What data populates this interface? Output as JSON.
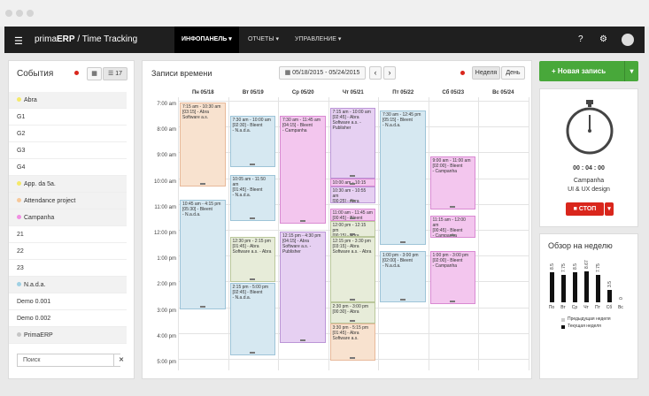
{
  "header": {
    "brand_prefix": "prima",
    "brand_bold": "ERP",
    "brand_suffix": " / Time Tracking",
    "nav": [
      {
        "label": "ИНФОПАНЕЛЬ ▾"
      },
      {
        "label": "ОТЧЕТЫ ▾"
      },
      {
        "label": "УПРАВЛЕНИЕ ▾"
      }
    ]
  },
  "events_panel": {
    "title": "События",
    "count": "17",
    "items": [
      {
        "label": "Abra",
        "color": "#f5e96a"
      },
      {
        "label": "G1",
        "color": ""
      },
      {
        "label": "G2",
        "color": ""
      },
      {
        "label": "G3",
        "color": ""
      },
      {
        "label": "G4",
        "color": ""
      },
      {
        "label": "App. da 5a.",
        "color": "#f5e96a"
      },
      {
        "label": "Attendance project",
        "color": "#f7c89a"
      },
      {
        "label": "Campanha",
        "color": "#f08fe2"
      },
      {
        "label": "21",
        "color": ""
      },
      {
        "label": "22",
        "color": ""
      },
      {
        "label": "23",
        "color": ""
      },
      {
        "label": "N.a.d.a.",
        "color": "#9fd0e3"
      },
      {
        "label": "Demo 0.001",
        "color": ""
      },
      {
        "label": "Demo 0.002",
        "color": ""
      },
      {
        "label": "PrimaERP",
        "color": "#c6c6c6"
      }
    ],
    "search_placeholder": "Поиск",
    "search_clear": "✕"
  },
  "calendar": {
    "title": "Записи времени",
    "date_range": "05/18/2015 - 05/24/2015",
    "prev": "‹",
    "next": "›",
    "view_week": "Неделя",
    "view_day": "День",
    "days": [
      "Пн 05/18",
      "Вт 05/19",
      "Ср 05/20",
      "Чт 05/21",
      "Пт 05/22",
      "Сб 05/23",
      "Вс 05/24"
    ],
    "times": [
      "7:00 am",
      "8:00 am",
      "9:00 am",
      "10:00 am",
      "11:00 am",
      "12:00 pm",
      "1:00 pm",
      "2:00 pm",
      "3:00 pm",
      "4:00 pm",
      "5:00 pm"
    ],
    "events": [
      {
        "day": 0,
        "start": 7.0,
        "end": 10.25,
        "color": "or",
        "time": "7:15 am - 10:30 am",
        "dur": "[03:15] - Abra",
        "desc": "Software a.s."
      },
      {
        "day": 0,
        "start": 10.75,
        "end": 15.0,
        "color": "bl",
        "time": "10:45 am - 4:15 pm",
        "dur": "[05:30] - Bleent",
        "desc": "- N.a.d.a."
      },
      {
        "day": 1,
        "start": 7.5,
        "end": 9.5,
        "color": "bl",
        "time": "7:30 am - 10:00 am",
        "dur": "[02:30] - Bleent",
        "desc": "- N.a.d.a."
      },
      {
        "day": 1,
        "start": 9.8,
        "end": 11.6,
        "color": "bl",
        "time": "10:05 am - 11:50 am",
        "dur": "[01:45] - Bleent",
        "desc": "- N.a.d.a."
      },
      {
        "day": 1,
        "start": 12.2,
        "end": 13.95,
        "color": "gr",
        "time": "12:30 pm - 2:15 pm",
        "dur": "[01:45] - Abra",
        "desc": "Software a.s. - Abra"
      },
      {
        "day": 1,
        "start": 14.0,
        "end": 16.8,
        "color": "bl",
        "time": "2:15 pm - 5:00 pm",
        "dur": "[02:45] - Bleent",
        "desc": "- N.a.d.a."
      },
      {
        "day": 2,
        "start": 7.5,
        "end": 11.7,
        "color": "pk",
        "time": "7:30 am - 11:45 am",
        "dur": "[04:15] - Bleent",
        "desc": "- Campanha"
      },
      {
        "day": 2,
        "start": 12.0,
        "end": 16.3,
        "color": "pu",
        "time": "12:15 pm - 4:30 pm",
        "dur": "[04:15] - Abra",
        "desc": "Software a.s. - Publisher"
      },
      {
        "day": 3,
        "start": 7.2,
        "end": 9.95,
        "color": "pu",
        "time": "7:15 am - 10:00 am",
        "dur": "[02:45] - Abra",
        "desc": "Software a.s. - Publisher"
      },
      {
        "day": 3,
        "start": 9.95,
        "end": 10.25,
        "color": "pk",
        "time": "10:00 am - 10:15",
        "dur": "[00:15] -",
        "desc": ""
      },
      {
        "day": 3,
        "start": 10.25,
        "end": 10.9,
        "color": "pu",
        "time": "10:30 am - 10:55 am",
        "dur": "[00:25] - Abra",
        "desc": "Software a.s. - P"
      },
      {
        "day": 3,
        "start": 11.1,
        "end": 11.6,
        "color": "pk",
        "time": "11:00 am - 11:45 am",
        "dur": "[00:45] - Bleent",
        "desc": ""
      },
      {
        "day": 3,
        "start": 11.6,
        "end": 12.2,
        "color": "gr",
        "time": "12:00 pm - 12:15 pm",
        "dur": "[00:15] - Abra",
        "desc": ""
      },
      {
        "day": 3,
        "start": 12.2,
        "end": 14.75,
        "color": "gr",
        "time": "12:15 pm - 3:30 pm",
        "dur": "[03:15] - Abra",
        "desc": "Software a.s. - Abra"
      },
      {
        "day": 3,
        "start": 14.75,
        "end": 15.55,
        "color": "gr",
        "time": "2:30 pm - 3:00 pm",
        "dur": "[00:30] - Abra",
        "desc": ""
      },
      {
        "day": 3,
        "start": 15.55,
        "end": 17.0,
        "color": "or",
        "time": "3:30 pm - 5:15 pm",
        "dur": "[01:45] - Abra",
        "desc": "Software a.s."
      },
      {
        "day": 4,
        "start": 7.3,
        "end": 12.5,
        "color": "bl",
        "time": "7:30 am - 12:45 pm",
        "dur": "[05:15] - Bleent",
        "desc": "- N.a.d.a."
      },
      {
        "day": 4,
        "start": 12.75,
        "end": 14.75,
        "color": "bl",
        "time": "1:00 pm - 3:00 pm",
        "dur": "[02:00] - Bleent",
        "desc": "- N.a.d.a."
      },
      {
        "day": 5,
        "start": 9.1,
        "end": 11.15,
        "color": "pk",
        "time": "9:00 am - 11:00 am",
        "dur": "[02:00] - Bleent",
        "desc": "- Campanha"
      },
      {
        "day": 5,
        "start": 11.4,
        "end": 12.25,
        "color": "pk",
        "time": "11:15 am - 12:00 am",
        "dur": "[00:45] - Bleent",
        "desc": "- Campanha"
      },
      {
        "day": 5,
        "start": 12.75,
        "end": 14.8,
        "color": "pk",
        "time": "1:00 pm - 3:00 pm",
        "dur": "[02:00] - Bleent",
        "desc": "- Campanha"
      }
    ]
  },
  "new_record": {
    "label": "+ Новая запись",
    "caret": "▾"
  },
  "timer": {
    "elapsed": "00 : 04 : 00",
    "project": "Campanha",
    "task": "UI & UX design",
    "stop_label": "■ СТОП",
    "stop_caret": "▾"
  },
  "week_overview": {
    "title": "Обзор на неделю",
    "days": [
      "По",
      "Вт",
      "Ср",
      "Чт",
      "Пт",
      "Сб",
      "Вс"
    ],
    "labels": [
      "8.5",
      "7.75",
      "8.5",
      "8.67",
      "7.75",
      "3.5",
      "0"
    ],
    "values": [
      8.5,
      7.75,
      8.5,
      8.67,
      7.75,
      3.5,
      0
    ],
    "legend_prev": "Предыдущая неделя",
    "legend_cur": "Текущая неделя"
  }
}
